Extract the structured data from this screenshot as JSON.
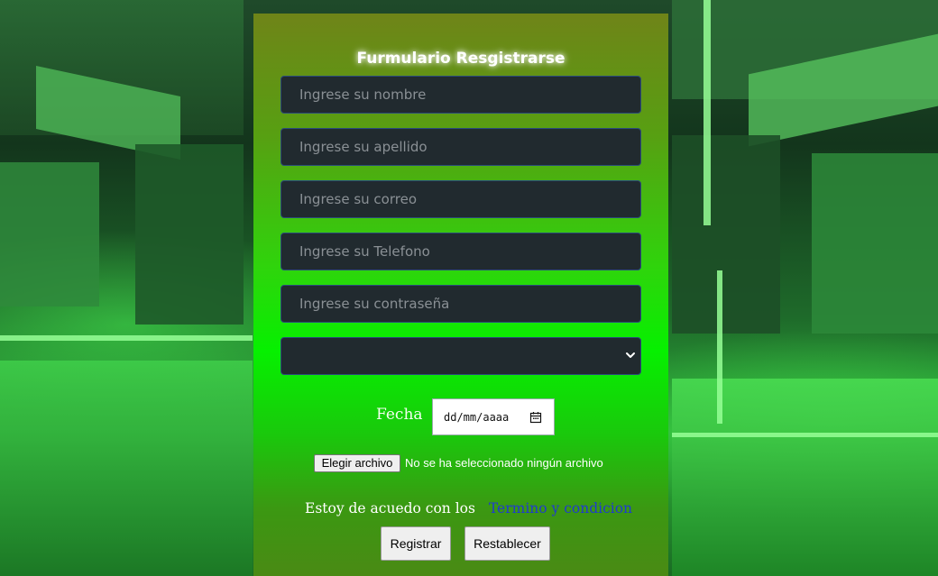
{
  "form": {
    "title": "Furmulario Resgistrarse",
    "fields": [
      {
        "placeholder": "Ingrese su nombre"
      },
      {
        "placeholder": "Ingrese su apellido"
      },
      {
        "placeholder": "Ingrese su correo"
      },
      {
        "placeholder": "Ingrese su Telefono"
      },
      {
        "placeholder": "Ingrese su contraseña"
      }
    ],
    "select": {
      "selected": ""
    },
    "date": {
      "label": "Fecha",
      "placeholder": "dd/mm/aaaa"
    },
    "file": {
      "button_label": "Elegir archivo",
      "status": "No se ha seleccionado ningún archivo"
    },
    "terms": {
      "text": "Estoy de acuedo con los",
      "link": "Termino y condicion"
    },
    "buttons": {
      "submit": "Registrar",
      "reset": "Restablecer"
    }
  },
  "colors": {
    "input_bg": "#212a2f",
    "link": "#1f3bd0",
    "title": "#ffffff"
  }
}
